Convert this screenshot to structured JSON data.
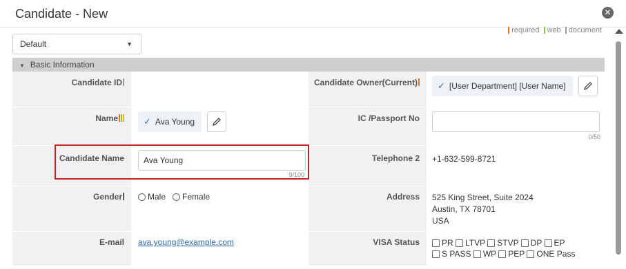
{
  "dialog": {
    "title": "Candidate - New",
    "close": "✕"
  },
  "legend": {
    "required": {
      "label": "required",
      "color": "#e8731a"
    },
    "web": {
      "label": "web",
      "color": "#8cbf3f"
    },
    "document": {
      "label": "document",
      "color": "#9a9a9a"
    }
  },
  "layout_select": {
    "value": "Default"
  },
  "section": {
    "title": "Basic Information"
  },
  "fields": {
    "candidate_id": {
      "label": "Candidate ID"
    },
    "candidate_owner": {
      "label": "Candidate Owner(Current)",
      "value": "[User Department] [User Name]"
    },
    "name": {
      "label": "Name",
      "value": "Ava Young"
    },
    "ic_passport": {
      "label": "IC /Passport No",
      "value": "",
      "counter": "0/50"
    },
    "candidate_name": {
      "label": "Candidate Name",
      "value": "Ava Young",
      "counter": "9/100"
    },
    "telephone2": {
      "label": "Telephone 2",
      "value": "+1-632-599-8721"
    },
    "gender": {
      "label": "Gender",
      "options": [
        "Male",
        "Female"
      ]
    },
    "address": {
      "label": "Address",
      "lines": [
        "525 King Street, Suite 2024",
        "Austin, TX 78701",
        "USA"
      ]
    },
    "email": {
      "label": "E-mail",
      "value": "ava.young@example.com"
    },
    "visa_status": {
      "label": "VISA Status",
      "options": [
        "PR",
        "LTVP",
        "STVP",
        "DP",
        "EP",
        "S PASS",
        "WP",
        "PEP",
        "ONE Pass"
      ]
    }
  }
}
